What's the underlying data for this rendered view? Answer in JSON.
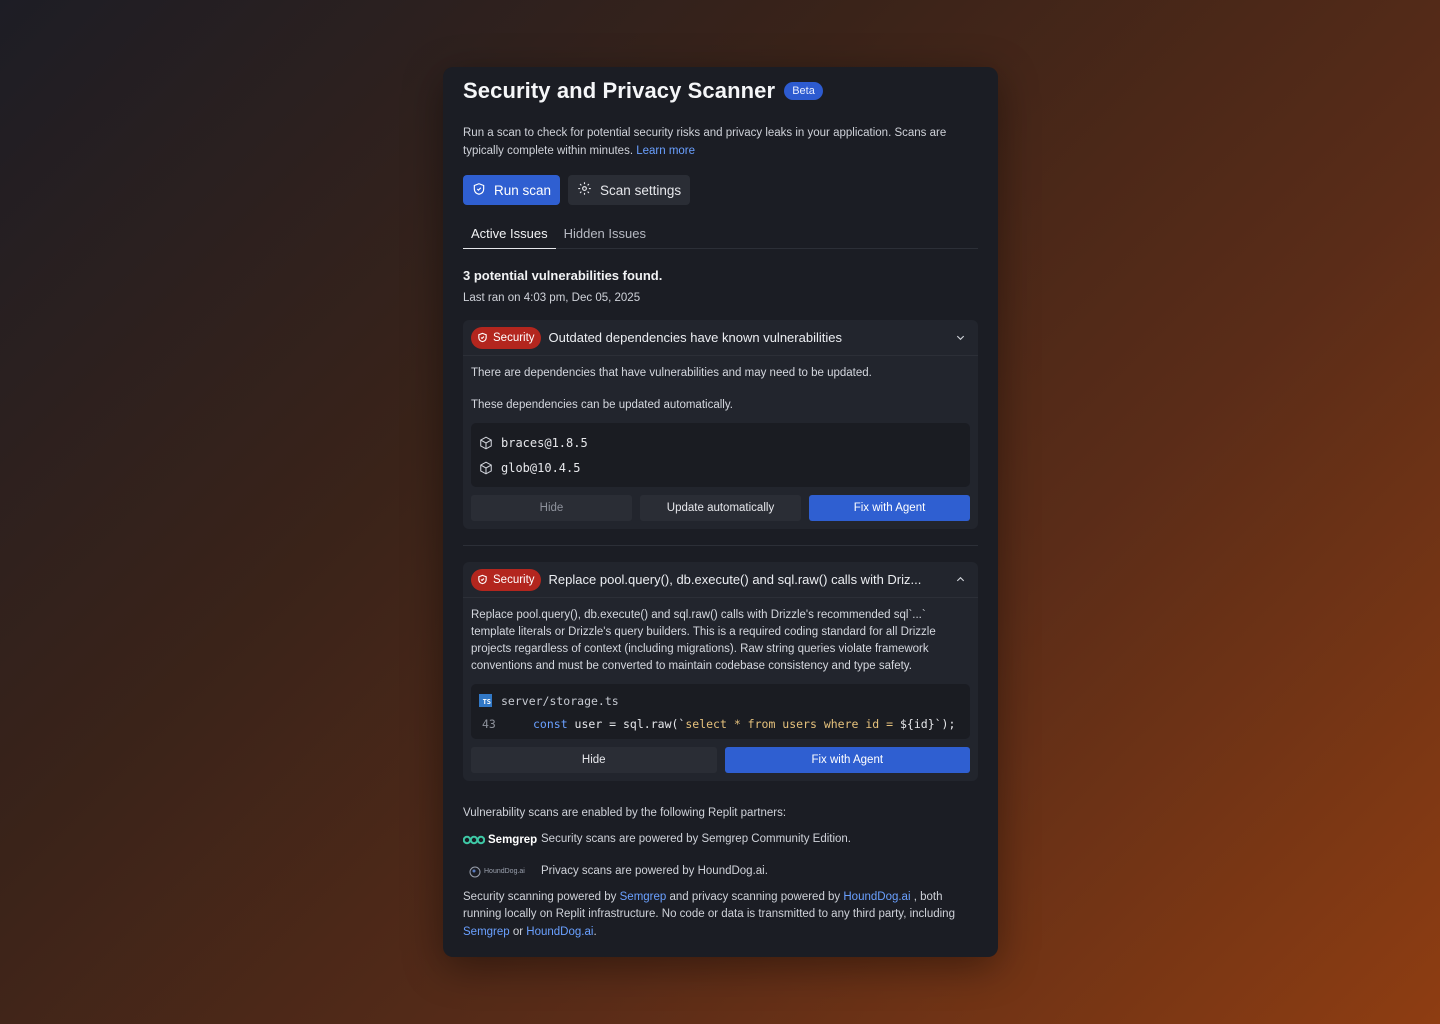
{
  "header": {
    "title": "Security and Privacy Scanner",
    "badge": "Beta"
  },
  "intro": {
    "text": "Run a scan to check for potential security risks and privacy leaks in your application. Scans are typically complete within minutes.",
    "link": "Learn more"
  },
  "actions": {
    "run_scan": "Run scan",
    "scan_settings": "Scan settings"
  },
  "tabs": [
    {
      "label": "Active Issues",
      "active": true
    },
    {
      "label": "Hidden Issues",
      "active": false
    }
  ],
  "summary": {
    "found": "3 potential vulnerabilities found.",
    "last_ran": "Last ran on 4:03 pm, Dec 05, 2025"
  },
  "issues": [
    {
      "badge": "Security",
      "title": "Outdated dependencies have known vulnerabilities",
      "desc1": "There are dependencies that have vulnerabilities and may need to be updated.",
      "desc2": "These dependencies can be updated automatically.",
      "deps": [
        "braces@1.8.5",
        "glob@10.4.5"
      ],
      "hide": "Hide",
      "update": "Update automatically",
      "fix": "Fix with Agent"
    },
    {
      "badge": "Security",
      "title": "Replace pool.query(), db.execute() and sql.raw() calls with Driz...",
      "desc": "Replace pool.query(), db.execute() and sql.raw() calls with Drizzle's recommended sql`...` template literals or Drizzle's query builders. This is a required coding standard for all Drizzle projects regardless of context (including migrations). Raw string queries violate framework conventions and must be converted to maintain codebase consistency and type safety.",
      "file": "server/storage.ts",
      "ts_label": "TS",
      "line_no": "43",
      "code": {
        "kw": "const",
        "mid": " user = sql.",
        "fn": "raw",
        "open": "(`",
        "str": "select * from users where id = ",
        "close": "${id}`);"
      },
      "hide": "Hide",
      "fix": "Fix with Agent"
    }
  ],
  "footer": {
    "partners_intro": "Vulnerability scans are enabled by the following Replit partners:",
    "semgrep_name": "Semgrep",
    "semgrep_text": "Security scans are powered by Semgrep Community Edition.",
    "hound_name": "HoundDog.ai",
    "hound_text": "Privacy scans are powered by HoundDog.ai.",
    "note_1": "Security scanning powered by ",
    "note_link_1": "Semgrep",
    "note_2": " and privacy scanning powered by ",
    "note_link_2": "HoundDog.ai",
    "note_3": " , both running locally on Replit infrastructure. No code or data is transmitted to any third party, including ",
    "note_link_3": "Semgrep",
    "note_4": " or ",
    "note_link_4": "HoundDog.ai",
    "note_5": "."
  },
  "colors": {
    "accent": "#2f5fd1",
    "danger": "#b3261e",
    "link": "#6aa0ff",
    "panel": "#1b1d24"
  }
}
